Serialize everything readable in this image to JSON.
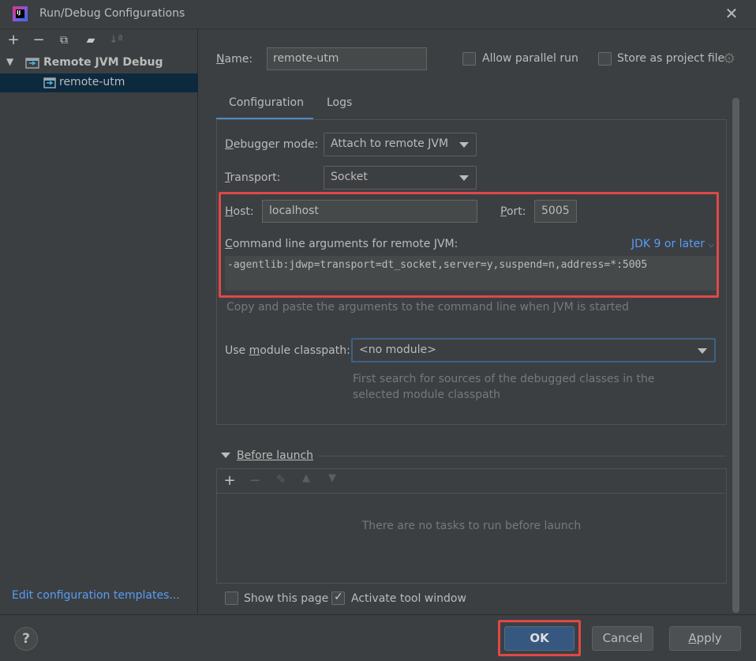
{
  "window": {
    "title": "Run/Debug Configurations",
    "app_icon_text": "IJ"
  },
  "toolbar": {
    "icons": [
      "add-icon",
      "remove-icon",
      "copy-icon",
      "new-folder-icon",
      "sort-icon"
    ]
  },
  "tree": {
    "group_label": "Remote JVM Debug",
    "child_label": "remote-utm"
  },
  "left": {
    "edit_templates": "Edit configuration templates..."
  },
  "form": {
    "name_label": "Name:",
    "name_value": "remote-utm",
    "allow_parallel_label": "Allow parallel run",
    "allow_parallel_checked": false,
    "store_label": "Store as project file",
    "store_checked": false
  },
  "tabs": [
    {
      "label": "Configuration",
      "active": true
    },
    {
      "label": "Logs",
      "active": false
    }
  ],
  "config": {
    "debugger_mode_label": "Debugger mode:",
    "debugger_mode_value": "Attach to remote JVM",
    "transport_label": "Transport:",
    "transport_value": "Socket",
    "host_label": "Host:",
    "host_value": "localhost",
    "port_label": "Port:",
    "port_value": "5005",
    "cmd_label": "Command line arguments for remote JVM:",
    "jdk_link": "JDK 9 or later",
    "cmd_value": "-agentlib:jdwp=transport=dt_socket,server=y,suspend=n,address=*:5005",
    "hint": "Copy and paste the arguments to the command line when JVM is started",
    "module_label": "Use module classpath:",
    "module_value": "<no module>",
    "module_desc": "First search for sources of the debugged classes in the selected module classpath"
  },
  "before_launch": {
    "label": "Before launch",
    "empty_text": "There are no tasks to run before launch"
  },
  "footer_options": {
    "show_page_label": "Show this page",
    "show_page_checked": false,
    "activate_label": "Activate tool window",
    "activate_checked": true
  },
  "buttons": {
    "help": "?",
    "ok": "OK",
    "cancel": "Cancel",
    "apply": "Apply"
  },
  "colors": {
    "background": "#3c3f41",
    "accent": "#4a88c7",
    "link": "#589df6",
    "highlight": "#e04848",
    "selection": "#0d293e"
  }
}
